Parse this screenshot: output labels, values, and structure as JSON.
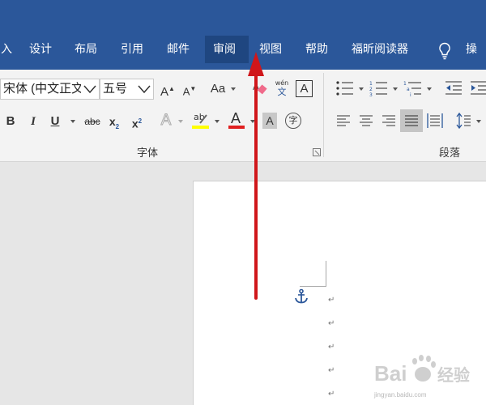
{
  "tabs": [
    {
      "label": "入",
      "active": false
    },
    {
      "label": "设计",
      "active": false
    },
    {
      "label": "布局",
      "active": false
    },
    {
      "label": "引用",
      "active": false
    },
    {
      "label": "邮件",
      "active": false
    },
    {
      "label": "审阅",
      "active": true
    },
    {
      "label": "视图",
      "active": false
    },
    {
      "label": "帮助",
      "active": false
    },
    {
      "label": "福昕阅读器",
      "active": false
    }
  ],
  "tell_me": "操作",
  "font": {
    "name": "宋体 (中文正文",
    "size": "五号",
    "grow": "A",
    "shrink": "A",
    "change_case": "Aa",
    "phonetic_top": "wén",
    "phonetic_bottom": "文",
    "char_border": "A",
    "bold": "B",
    "italic": "I",
    "underline": "U",
    "strikethrough": "abc",
    "subscript": "x",
    "subscript_sub": "2",
    "superscript": "x",
    "superscript_sup": "2",
    "text_effects": "A",
    "highlight": "ab",
    "font_color": "A",
    "char_shading": "A",
    "enclose": "字",
    "group_label": "字体"
  },
  "paragraph": {
    "group_label": "段落"
  },
  "colors": {
    "brand_blue": "#2b579a",
    "active_tab": "#1f4680",
    "highlight_yellow": "#ffff00",
    "font_red": "#e02020",
    "arrow_red": "#d0161a"
  },
  "watermark": {
    "brand": "Bai",
    "brand_tail": "经验",
    "url": "jingyan.baidu.com"
  }
}
